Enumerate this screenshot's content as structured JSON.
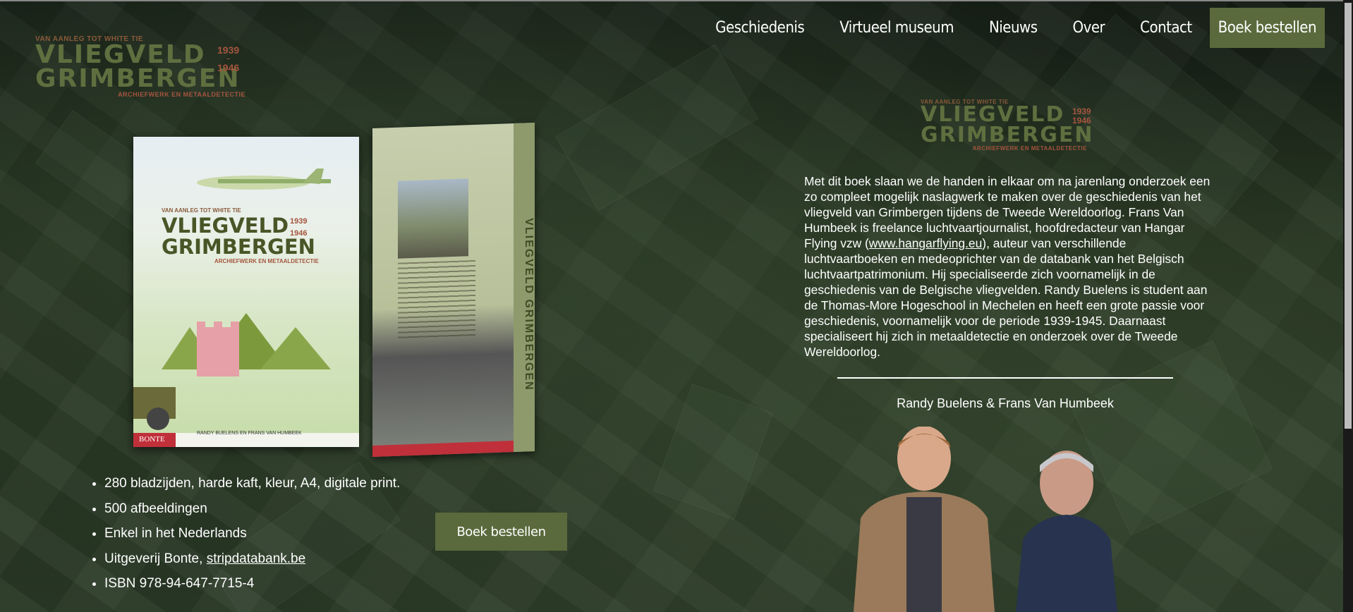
{
  "logo": {
    "tagline": "VAN AANLEG TOT WHITE TIE",
    "title_line1": "VLIEGVELD",
    "title_line2": "GRIMBERGEN",
    "year_start": "1939",
    "year_end": "1946",
    "subtitle": "ARCHIEFWERK EN METAALDETECTIE"
  },
  "nav": {
    "items": [
      "Geschiedenis",
      "Virtueel museum",
      "Nieuws",
      "Over",
      "Contact"
    ],
    "order_label": "Boek bestellen"
  },
  "book": {
    "front_tagline": "VAN AANLEG TOT WHITE TIE",
    "front_title1": "VLIEGVELD",
    "front_title2": "GRIMBERGEN",
    "front_year_start": "1939",
    "front_year_end": "1946",
    "front_subtitle": "ARCHIEFWERK EN METAALDETECTIE",
    "front_authors": "RANDY BUELENS EN FRANS VAN HUMBEEK",
    "publisher": "BONTE",
    "spine_title": "VLIEGVELD GRIMBERGEN"
  },
  "features": [
    {
      "text": "280 bladzijden, harde kaft, kleur, A4, digitale print."
    },
    {
      "text": "500 afbeeldingen"
    },
    {
      "text": "Enkel in het Nederlands"
    },
    {
      "text": "Uitgeverij Bonte, ",
      "link": "stripdatabank.be"
    },
    {
      "text": "ISBN 978-94-647-7715-4"
    }
  ],
  "order_button": "Boek bestellen",
  "description": {
    "part1": "Met dit boek slaan we de handen in elkaar om na jarenlang onderzoek een zo compleet mogelijk naslagwerk te maken over de geschiedenis van het vliegveld van Grimbergen tijdens de Tweede Wereldoorlog. Frans Van Humbeek is freelance luchtvaartjournalist, hoofdredacteur van Hangar Flying vzw (",
    "link": "www.hangarflying.eu",
    "part2": "), auteur van verschillende luchtvaartboeken en medeoprichter van de databank van het Belgisch luchtvaartpatrimonium. Hij specialiseerde zich voornamelijk in de geschiedenis van de Belgische vliegvelden. Randy Buelens is student aan de Thomas-More Hogeschool in Mechelen en heeft een grote passie voor geschiedenis, voornamelijk voor de periode 1939-1945. Daarnaast specialiseert hij zich in metaaldetectie en onderzoek over de Tweede Wereldoorlog."
  },
  "authors_caption": "Randy Buelens & Frans Van Humbeek"
}
